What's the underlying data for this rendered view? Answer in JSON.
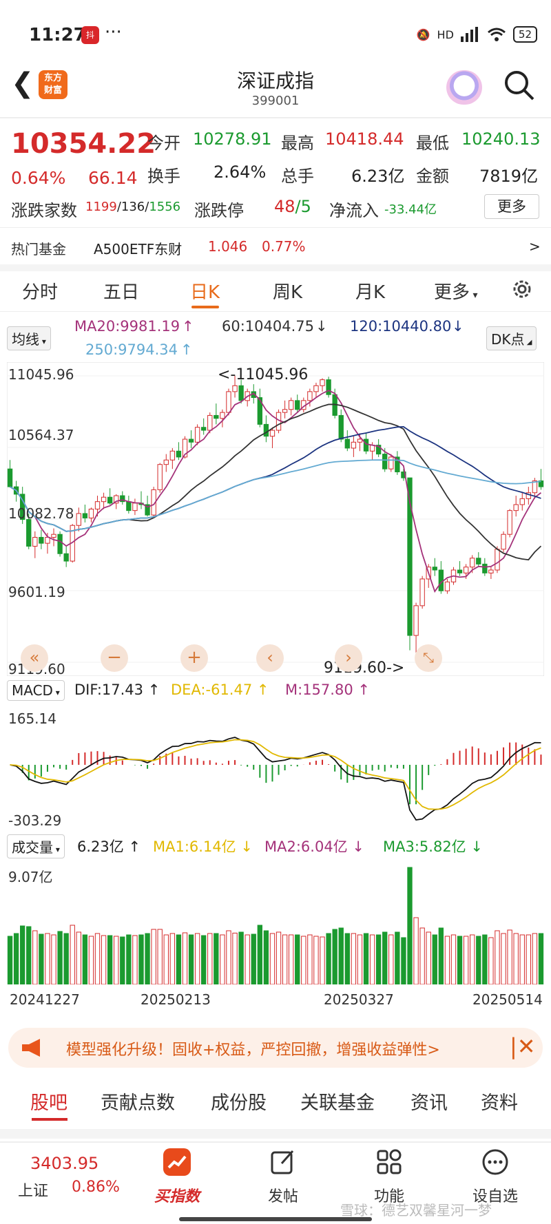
{
  "status": {
    "time": "11:27",
    "battery": "52",
    "app_badge": "抖",
    "signal": "HD"
  },
  "header": {
    "logo": "东方\n财富",
    "title": "深证成指",
    "code": "399001"
  },
  "quote": {
    "price": "10354.22",
    "pct": "0.64%",
    "change": "66.14",
    "open_label": "今开",
    "open": "10278.91",
    "high_label": "最高",
    "high": "10418.44",
    "low_label": "最低",
    "low": "10240.13",
    "turnover_label": "换手",
    "turnover": "2.64%",
    "volume_label": "总手",
    "volume": "6.23亿",
    "amount_label": "金额",
    "amount": "7819亿",
    "breadth_label": "涨跌家数",
    "breadth_up": "1199",
    "breadth_flat": "/136/",
    "breadth_down": "1556",
    "limit_label": "涨跌停",
    "limit_up": "48",
    "limit_down": "/5",
    "netflow_label": "净流入",
    "netflow": "-33.44亿",
    "more_label": "更多"
  },
  "hot_fund": {
    "label": "热门基金",
    "name": "A500ETF东财",
    "price": "1.046",
    "pct": "0.77%",
    "arrow": ">"
  },
  "period_tabs": [
    "分时",
    "五日",
    "日K",
    "周K",
    "月K",
    "更多"
  ],
  "ma_legend": {
    "selector": "均线",
    "ma20": "MA20:9981.19",
    "ma60": "60:10404.75",
    "ma120": "120:10440.80",
    "ma250": "250:9794.34",
    "dk": "DK点"
  },
  "kchart": {
    "y_labels": [
      "11045.96",
      "10564.37",
      "10082.78",
      "9601.19",
      "9119.60"
    ],
    "max_note": "<-11045.96",
    "min_note": "9119.60->"
  },
  "macd": {
    "selector": "MACD",
    "dif": "DIF:17.43",
    "dea": "DEA:-61.47",
    "m": "M:157.80",
    "top": "165.14",
    "bottom": "-303.29"
  },
  "volume": {
    "selector": "成交量",
    "value": "6.23亿",
    "ma1": "MA1:6.14亿",
    "ma2": "MA2:6.04亿",
    "ma3": "MA3:5.82亿",
    "top": "9.07亿"
  },
  "dates": [
    "20241227",
    "20250213",
    "20250327",
    "20250514"
  ],
  "banner": {
    "text": "模型强化升级！固收+权益，严控回撤，增强收益弹性>"
  },
  "bottom_tabs": [
    "股吧",
    "贡献点数",
    "成份股",
    "关联基金",
    "资讯",
    "资料"
  ],
  "bottom_nav": {
    "index_value": "3403.95",
    "index_name": "上证",
    "index_pct": "0.86%",
    "items": [
      "买指数",
      "发帖",
      "功能",
      "设自选"
    ]
  },
  "watermark": "雪球：德艺双馨星河一梦",
  "colors": {
    "up": "#d42a2a",
    "down": "#1b9a2f",
    "accent": "#e86b1b"
  },
  "chart_data": {
    "type": "candlestick",
    "ylim": [
      9119.6,
      11045.96
    ],
    "x_range": [
      "20241227",
      "20250514"
    ],
    "candles": [
      [
        10420,
        10480,
        10380,
        10300
      ],
      [
        10300,
        10340,
        10200,
        10250
      ],
      [
        10250,
        10300,
        10050,
        10080
      ],
      [
        10080,
        10120,
        9880,
        9900
      ],
      [
        9900,
        10000,
        9820,
        9960
      ],
      [
        9960,
        10010,
        9880,
        9920
      ],
      [
        9920,
        9990,
        9850,
        9960
      ],
      [
        9960,
        10020,
        9900,
        9980
      ],
      [
        9980,
        10000,
        9830,
        9850
      ],
      [
        9850,
        9900,
        9760,
        9800
      ],
      [
        9800,
        10050,
        9790,
        10040
      ],
      [
        10040,
        10160,
        10000,
        10120
      ],
      [
        10120,
        10180,
        10060,
        10090
      ],
      [
        10090,
        10160,
        10060,
        10150
      ],
      [
        10150,
        10240,
        10100,
        10200
      ],
      [
        10200,
        10260,
        10150,
        10230
      ],
      [
        10230,
        10290,
        10180,
        10190
      ],
      [
        10190,
        10250,
        10150,
        10240
      ],
      [
        10240,
        10270,
        10180,
        10200
      ],
      [
        10200,
        10240,
        10120,
        10140
      ],
      [
        10140,
        10220,
        10110,
        10190
      ],
      [
        10190,
        10270,
        10150,
        10180
      ],
      [
        10180,
        10240,
        10100,
        10110
      ],
      [
        10110,
        10300,
        10100,
        10280
      ],
      [
        10280,
        10460,
        10260,
        10450
      ],
      [
        10450,
        10520,
        10400,
        10480
      ],
      [
        10480,
        10560,
        10420,
        10540
      ],
      [
        10540,
        10600,
        10480,
        10500
      ],
      [
        10500,
        10640,
        10490,
        10620
      ],
      [
        10620,
        10680,
        10560,
        10600
      ],
      [
        10600,
        10720,
        10580,
        10700
      ],
      [
        10700,
        10760,
        10650,
        10680
      ],
      [
        10680,
        10800,
        10660,
        10780
      ],
      [
        10780,
        10860,
        10720,
        10760
      ],
      [
        10760,
        10820,
        10700,
        10800
      ],
      [
        10800,
        10960,
        10780,
        10940
      ],
      [
        10940,
        11046,
        10900,
        10980
      ],
      [
        10980,
        11020,
        10860,
        10880
      ],
      [
        10880,
        10960,
        10840,
        10940
      ],
      [
        10940,
        10990,
        10860,
        10900
      ],
      [
        10900,
        10960,
        10700,
        10720
      ],
      [
        10720,
        10780,
        10600,
        10640
      ],
      [
        10640,
        10700,
        10560,
        10680
      ],
      [
        10680,
        10820,
        10660,
        10800
      ],
      [
        10800,
        10880,
        10760,
        10820
      ],
      [
        10820,
        10900,
        10780,
        10880
      ],
      [
        10880,
        10920,
        10800,
        10820
      ],
      [
        10820,
        10900,
        10800,
        10880
      ],
      [
        10880,
        10960,
        10840,
        10940
      ],
      [
        10940,
        11000,
        10900,
        10980
      ],
      [
        10980,
        11030,
        10940,
        11020
      ],
      [
        11020,
        11040,
        10900,
        10920
      ],
      [
        10920,
        10960,
        10760,
        10780
      ],
      [
        10780,
        10820,
        10600,
        10620
      ],
      [
        10620,
        10680,
        10540,
        10560
      ],
      [
        10560,
        10640,
        10500,
        10600
      ],
      [
        10600,
        10660,
        10540,
        10620
      ],
      [
        10620,
        10660,
        10520,
        10540
      ],
      [
        10540,
        10600,
        10480,
        10580
      ],
      [
        10580,
        10620,
        10500,
        10520
      ],
      [
        10520,
        10560,
        10400,
        10420
      ],
      [
        10420,
        10520,
        10400,
        10500
      ],
      [
        10500,
        10540,
        10380,
        10400
      ],
      [
        10400,
        10420,
        10340,
        10360
      ],
      [
        10360,
        10300,
        9200,
        9300
      ],
      [
        9300,
        9520,
        9150,
        9500
      ],
      [
        9500,
        9700,
        9480,
        9680
      ],
      [
        9680,
        9780,
        9620,
        9760
      ],
      [
        9760,
        9820,
        9700,
        9740
      ],
      [
        9740,
        9800,
        9580,
        9600
      ],
      [
        9600,
        9680,
        9580,
        9660
      ],
      [
        9660,
        9760,
        9640,
        9740
      ],
      [
        9740,
        9800,
        9700,
        9720
      ],
      [
        9720,
        9780,
        9680,
        9760
      ],
      [
        9760,
        9840,
        9720,
        9820
      ],
      [
        9820,
        9860,
        9760,
        9780
      ],
      [
        9780,
        9820,
        9700,
        9720
      ],
      [
        9720,
        9760,
        9680,
        9740
      ],
      [
        9740,
        9900,
        9720,
        9880
      ],
      [
        9880,
        10000,
        9860,
        9980
      ],
      [
        9980,
        10150,
        9960,
        10140
      ],
      [
        10140,
        10240,
        10100,
        10180
      ],
      [
        10180,
        10260,
        10140,
        10220
      ],
      [
        10220,
        10300,
        10180,
        10260
      ],
      [
        10260,
        10360,
        10220,
        10340
      ],
      [
        10340,
        10420,
        10280,
        10300
      ]
    ]
  }
}
